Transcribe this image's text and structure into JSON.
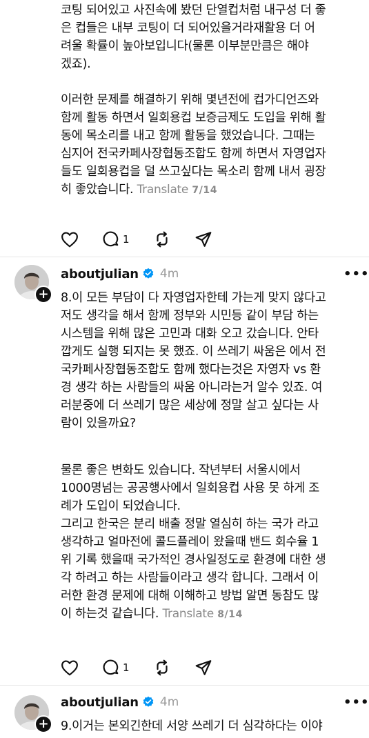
{
  "post1": {
    "para1": "코팅 되어있고 사진속에 봤던 단열컵처럼 내구성 더 좋\n은 컵들은 내부 코팅이 더 되어있을거라재활용 더 어\n려울 확률이 높아보입니다(물론 이부분만큼은 해야\n겠죠).",
    "para2": "이러한 문제를 해결하기 위해 몇년전에 컵가디언즈와\n함께 활동 하면서 일회용컵 보증금제도 도입을 위해 활\n동에 목소리를 내고 함께 활동을 했었습니다. 그때는\n심지어 전국카페사장협동조합도 함께 하면서 자영업자\n들도 일회용컵을 덜 쓰고싶다는 목소리 함께 내서 굉장\n히 좋았습니다. ",
    "translate": "Translate",
    "page": "7/14",
    "replies": "1"
  },
  "post2": {
    "username": "aboutjulian",
    "time": "4m",
    "para1": "8.이 모든 부담이 다 자영업자한테 가는게 맞지 않다고\n저도 생각을 해서 함께 정부와 시민등 같이 부담 하는\n시스템을 위해 많은 고민과 대화 오고 갔습니다. 안타\n깝게도 실행 되지는 못 했죠. 이 쓰레기 싸움은 에서 전\n국카페사장협동조합도 함께 했다는것은 자영자 vs 환\n경 생각 하는 사람들의 싸움 아니라는거 알수 있죠. 여\n러분중에 더 쓰레기 많은 세상에 정말 살고 싶다는 사\n람이 있을까요?",
    "para2": "물론 좋은 변화도 있습니다. 작년부터 서울시에서\n1000명넘는 공공행사에서 일회용컵 사용 못 하게 조\n례가 도입이 되었습니다.\n그리고 한국은 분리 배출 정말 열심히 하는 국가 라고\n생각하고 얼마전에 콜드플레이 왔을때 밴드 회수율 1\n위 기록 했을때 국가적인 경사일정도로 환경에 대한 생\n각 하려고 하는 사람들이라고 생각 합니다. 그래서 이\n러한 환경 문제에 대해 이해하고 방법 알면 동참도 많\n이 하는것 같습니다. ",
    "translate": "Translate",
    "page": "8/14",
    "replies": "1"
  },
  "post3": {
    "username": "aboutjulian",
    "time": "4m",
    "para1": "9.이거는 본외긴한데 서양 쓰레기 더 심각하다는 이야"
  },
  "more_label": "•••",
  "colors": {
    "text": "#111111",
    "muted": "#8a8a8a",
    "verified": "#0095f6"
  },
  "icons": [
    "heart-icon",
    "comment-icon",
    "repost-icon",
    "share-icon",
    "verified-icon",
    "plus-icon",
    "more-icon"
  ]
}
